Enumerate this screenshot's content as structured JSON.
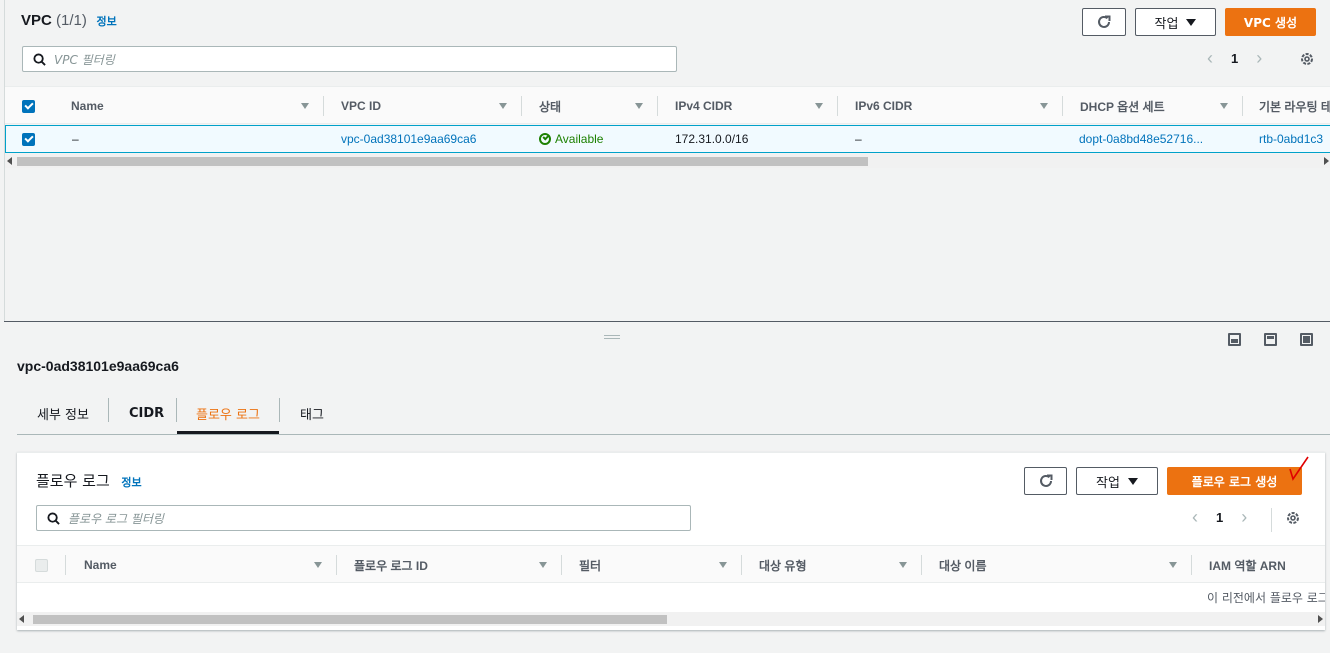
{
  "vpc_panel": {
    "title": "VPC",
    "count": "(1/1)",
    "info": "정보",
    "actions_label": "작업",
    "create_label": "VPC 생성",
    "search_placeholder": "VPC 필터링",
    "page": "1",
    "columns": [
      "Name",
      "VPC ID",
      "상태",
      "IPv4 CIDR",
      "IPv6 CIDR",
      "DHCP 옵션 세트",
      "기본 라우팅 테이블"
    ],
    "row": {
      "name": "–",
      "vpc_id": "vpc-0ad38101e9aa69ca6",
      "status": "Available",
      "ipv4": "172.31.0.0/16",
      "ipv6": "–",
      "dhcp": "dopt-0a8bd48e52716...",
      "route_table": "rtb-0abd1c3"
    }
  },
  "details": {
    "selected_id": "vpc-0ad38101e9aa69ca6",
    "tabs": [
      "세부 정보",
      "CIDR",
      "플로우 로그",
      "태그"
    ],
    "active_tab": "플로우 로그"
  },
  "flow_panel": {
    "title": "플로우 로그",
    "info": "정보",
    "actions_label": "작업",
    "create_label": "플로우 로그 생성",
    "search_placeholder": "플로우 로그 필터링",
    "page": "1",
    "columns": [
      "Name",
      "플로우 로그 ID",
      "필터",
      "대상 유형",
      "대상 이름",
      "IAM 역할 ARN"
    ],
    "empty_message": "이 리전에서 플로우 로그가 없습니다"
  },
  "colors": {
    "accent": "#ec7211",
    "link": "#0073bb",
    "success": "#1d8102"
  },
  "icons": [
    "refresh-icon",
    "settings-icon",
    "search-icon",
    "check-circle-icon",
    "layout-icon"
  ]
}
